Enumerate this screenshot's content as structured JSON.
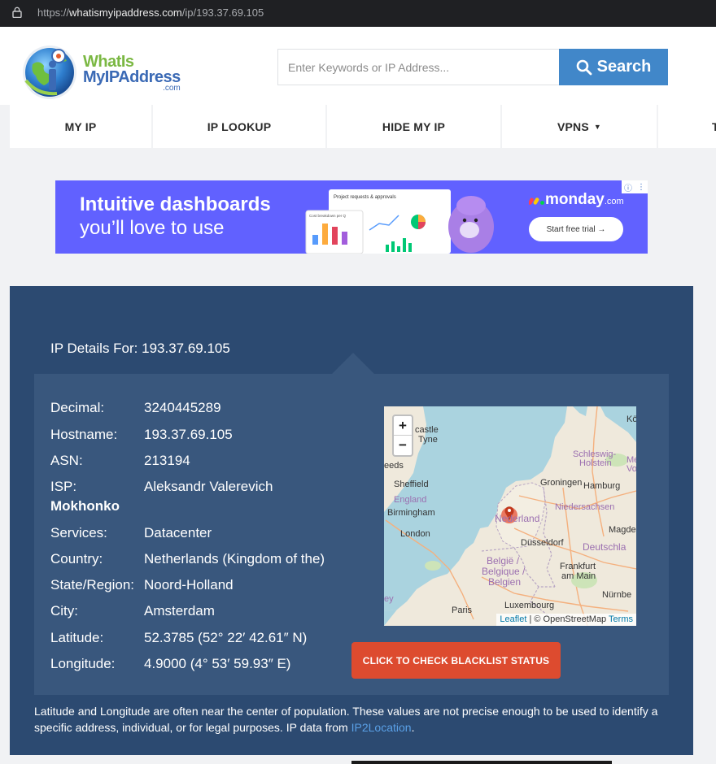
{
  "browser": {
    "url_scheme": "https://",
    "url_host": "whatismyipaddress.com",
    "url_path": "/ip/193.37.69.105"
  },
  "logo": {
    "line1": "WhatIs",
    "line2": "MyIPAddress",
    "line3": ".com"
  },
  "search": {
    "placeholder": "Enter Keywords or IP Address...",
    "button_label": "Search"
  },
  "nav": {
    "items": [
      {
        "label": "MY IP"
      },
      {
        "label": "IP LOOKUP"
      },
      {
        "label": "HIDE MY IP"
      },
      {
        "label": "VPNS",
        "dropdown": "▼"
      },
      {
        "label": "T"
      }
    ]
  },
  "ad": {
    "headline": "Intuitive dashboards",
    "subline": "you’ll love to use",
    "brand": "monday",
    "brand_suffix": ".com",
    "cta": "Start free trial →",
    "art_title": "Project requests & approvals",
    "art_chart_title": "Cost breakdown per Q",
    "bg_color": "#6161ff"
  },
  "details": {
    "title": "IP Details For: 193.37.69.105",
    "rows": [
      {
        "label": "Decimal:",
        "value": "3240445289"
      },
      {
        "label": "Hostname:",
        "value": "193.37.69.105"
      },
      {
        "label": "ASN:",
        "value": "213194"
      },
      {
        "label": "ISP:",
        "value": "Aleksandr Valerevich",
        "continuation": "Mokhonko"
      },
      {
        "label": "Services:",
        "value": "Datacenter"
      },
      {
        "label": "Country:",
        "value": "Netherlands (Kingdom of the)"
      },
      {
        "label": "State/Region:",
        "value": "Noord-Holland"
      },
      {
        "label": "City:",
        "value": "Amsterdam"
      },
      {
        "label": "Latitude:",
        "value": "52.3785 (52° 22′ 42.61″ N)"
      },
      {
        "label": "Longitude:",
        "value": "4.9000 (4° 53′ 59.93″ E)"
      }
    ],
    "blacklist_button": "CLICK TO CHECK BLACKLIST STATUS"
  },
  "map": {
    "zoom_in": "+",
    "zoom_out": "−",
    "labels": {
      "newcastle": "castle",
      "tyne": "Tyne",
      "leeds": "eeds",
      "sheffield": "Sheffield",
      "england": "England",
      "birmingham": "Birmingham",
      "london": "London",
      "groningen": "Groningen",
      "hamburg": "Hamburg",
      "schleswig": "Schleswig-",
      "holstein": "Holstein",
      "kiel": "Kö",
      "me": "Me",
      "vo": "Vo",
      "nederland": "Nederland",
      "niedersachsen": "Niedersachsen",
      "magdeburg": "Magde",
      "dusseldorf": "Düsseldorf",
      "deutschland": "Deutschla",
      "belgie1": "België /",
      "belgie2": "Belgique /",
      "belgie3": "Belgien",
      "frankfurt1": "Frankfurt",
      "frankfurt2": "am Main",
      "ey": "ey",
      "paris": "Paris",
      "luxembourg": "Luxembourg",
      "nurnberg": "Nürnbe"
    },
    "attribution_leaflet": "Leaflet",
    "attribution_sep": " | © OpenStreetMap ",
    "attribution_terms": "Terms"
  },
  "disclaimer": {
    "text": "Latitude and Longitude are often near the center of population. These values are not precise enough to be used to identify a specific address, individual, or for legal purposes. IP data from ",
    "source": "IP2Location",
    "end": "."
  }
}
